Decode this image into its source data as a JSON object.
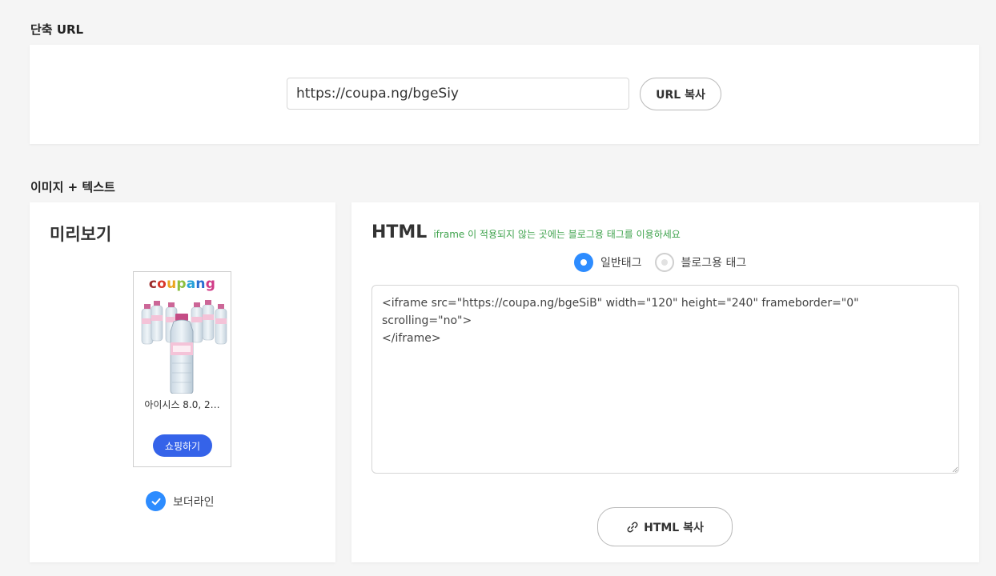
{
  "short_url": {
    "section_title": "단축 URL",
    "url_value": "https://coupa.ng/bgeSiy",
    "copy_button": "URL 복사"
  },
  "image_text": {
    "section_title": "이미지 + 텍스트",
    "preview": {
      "heading": "미리보기",
      "logo_letters": [
        "c",
        "o",
        "u",
        "p",
        "a",
        "n",
        "g"
      ],
      "product_name": "아이시스 8.0, 2…",
      "shop_button": "쇼핑하기",
      "border_label": "보더라인"
    },
    "html": {
      "heading": "HTML",
      "note": "iframe 이 적용되지 않는 곳에는 블로그용 태그를 이용하세요",
      "radio_normal": "일반태그",
      "radio_blog": "블로그용 태그",
      "code": "<iframe src=\"https://coupa.ng/bgeSiB\" width=\"120\" height=\"240\" frameborder=\"0\" scrolling=\"no\">\n</iframe>",
      "copy_button": "HTML 복사"
    }
  },
  "colors": {
    "accent_blue": "#2d8cff",
    "shop_button": "#3563e9",
    "note_green": "#3fa34d",
    "logo": [
      "#9c2a2a",
      "#d8372b",
      "#e9a51f",
      "#8cbf3f",
      "#27a1d9",
      "#2a6fd1",
      "#d03b87"
    ]
  },
  "icons": {
    "check": "check-icon",
    "link": "link-icon"
  }
}
